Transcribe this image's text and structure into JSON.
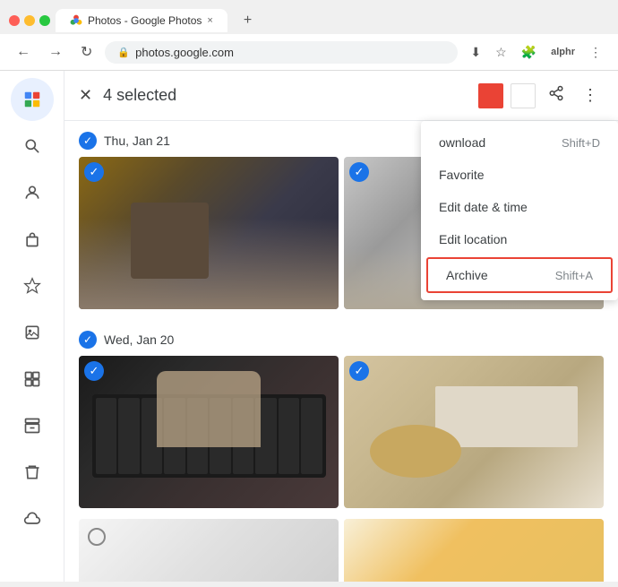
{
  "browser": {
    "tab_title": "Photos - Google Photos",
    "url": "photos.google.com",
    "new_tab_symbol": "+",
    "tab_close": "×"
  },
  "nav": {
    "back": "←",
    "forward": "→",
    "refresh": "↻",
    "lock": "🔒",
    "download_icon": "⬇",
    "star_icon": "☆",
    "puzzle_icon": "🧩",
    "ext_label": "alphr",
    "more_icon": "⋮"
  },
  "header": {
    "close_icon": "✕",
    "selected_text": "4 selected"
  },
  "sidebar": {
    "items": [
      {
        "name": "photos-home",
        "icon": "🏠",
        "active": true
      },
      {
        "name": "search",
        "icon": "🔍",
        "active": false
      },
      {
        "name": "people",
        "icon": "👤",
        "active": false
      },
      {
        "name": "shopping",
        "icon": "🛍",
        "active": false
      },
      {
        "name": "favorites",
        "icon": "☆",
        "active": false
      },
      {
        "name": "albums",
        "icon": "📷",
        "active": false
      },
      {
        "name": "utilities",
        "icon": "🗂",
        "active": false
      },
      {
        "name": "archive-side",
        "icon": "⬇",
        "active": false
      },
      {
        "name": "trash",
        "icon": "🗑",
        "active": false
      },
      {
        "name": "google-lens",
        "icon": "☁",
        "active": false
      }
    ]
  },
  "dates": [
    {
      "label": "Thu, Jan 21"
    },
    {
      "label": "Wed, Jan 20"
    }
  ],
  "menu": {
    "items": [
      {
        "label": "Download",
        "shortcut": "Shift+D",
        "highlighted": false,
        "partial": true
      },
      {
        "label": "Favorite",
        "shortcut": "",
        "highlighted": false
      },
      {
        "label": "Edit date & time",
        "shortcut": "",
        "highlighted": false
      },
      {
        "label": "Edit location",
        "shortcut": "",
        "highlighted": false
      },
      {
        "label": "Archive",
        "shortcut": "Shift+A",
        "highlighted": true
      }
    ]
  },
  "colors": {
    "accent_blue": "#1a73e8",
    "swatch1": "#ea4335",
    "swatch2": "#ffffff"
  }
}
